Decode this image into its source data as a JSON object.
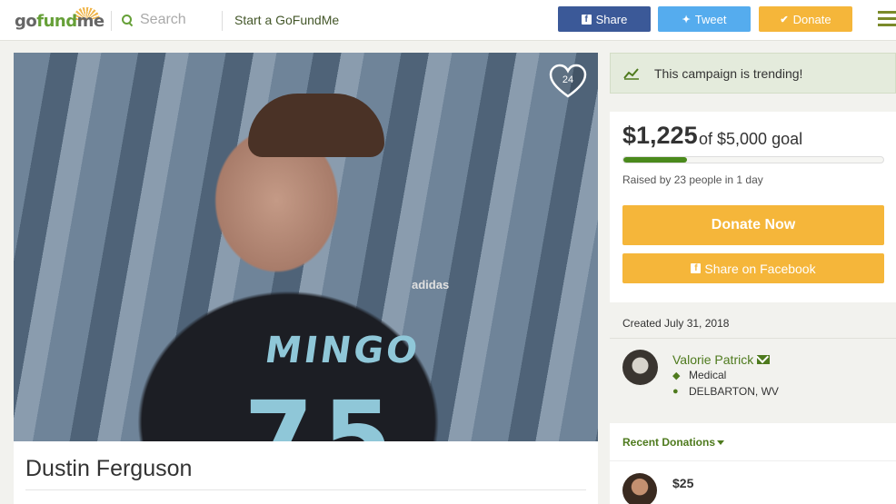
{
  "header": {
    "logo_text_left": "go",
    "logo_text_mid": "fund",
    "logo_text_right": "me",
    "search_placeholder": "Search",
    "start_link": "Start a GoFundMe",
    "share_label": "Share",
    "tweet_label": "Tweet",
    "donate_label": "Donate",
    "colors": {
      "facebook": "#3b5998",
      "twitter": "#55acee",
      "donate": "#f5b63a",
      "brand_green": "#66a038"
    }
  },
  "campaign": {
    "title": "Dustin Ferguson",
    "heart_count": "24",
    "photo_jersey_text": "MINGO",
    "photo_jersey_number": "75",
    "photo_brand": "adidas"
  },
  "sidebar": {
    "trending_text": "This campaign is trending!",
    "amount_raised": "$1,225",
    "goal_text": "of $5,000 goal",
    "progress_fraction": 0.245,
    "raised_by": "Raised by 23 people in 1 day",
    "donate_now_label": "Donate Now",
    "share_facebook_label": "Share on Facebook",
    "created": "Created July 31, 2018",
    "organizer_name": "Valorie Patrick",
    "category": "Medical",
    "location": "DELBARTON, WV",
    "recent_donations_label": "Recent Donations",
    "donations": [
      {
        "amount": "$25"
      }
    ]
  }
}
